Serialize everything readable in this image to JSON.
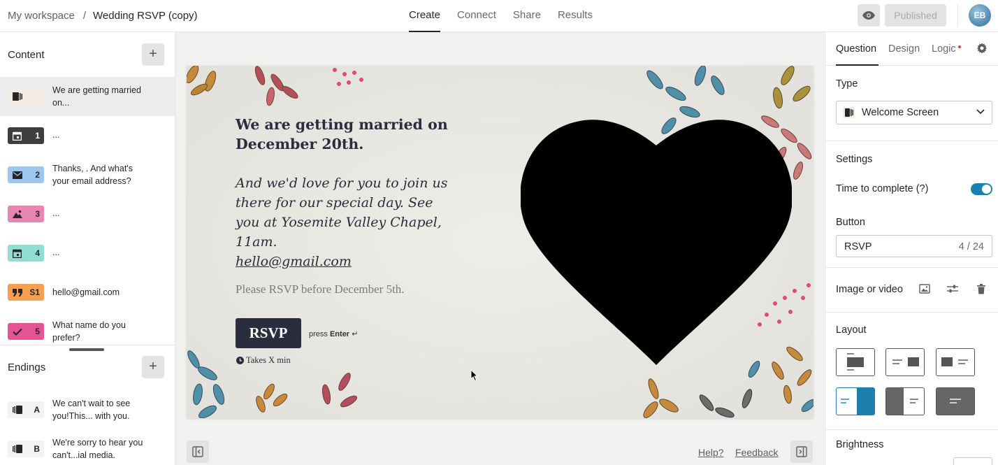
{
  "breadcrumb": {
    "workspace": "My workspace",
    "separator": "/",
    "form": "Wedding RSVP (copy)"
  },
  "nav": {
    "tabs": [
      "Create",
      "Connect",
      "Share",
      "Results"
    ],
    "active": "Create"
  },
  "header": {
    "published_label": "Published",
    "avatar_initials": "EB"
  },
  "content": {
    "title": "Content",
    "add_label": "+",
    "items": [
      {
        "badge": "",
        "icon": "welcome-screen-icon",
        "color": "#f3ece3",
        "text": "We are getting married on..."
      },
      {
        "badge": "1",
        "icon": "calendar-icon",
        "color": "#3e3e3e",
        "text": "..."
      },
      {
        "badge": "2",
        "icon": "email-icon",
        "color": "#9fc6ee",
        "text": "Thanks, . And what's your email address?"
      },
      {
        "badge": "3",
        "icon": "picture-choice-icon",
        "color": "#e785b3",
        "text": "..."
      },
      {
        "badge": "4",
        "icon": "calendar-icon",
        "color": "#8fddd4",
        "text": "..."
      },
      {
        "badge": "S1",
        "icon": "statement-quote-icon",
        "color": "#f5a04e",
        "text": "hello@gmail.com"
      },
      {
        "badge": "5",
        "icon": "checkmark-icon",
        "color": "#e45495",
        "text": "What name do you prefer?"
      }
    ]
  },
  "endings": {
    "title": "Endings",
    "add_label": "+",
    "items": [
      {
        "badge": "A",
        "icon": "ending-screen-icon",
        "text": "We can't wait to see you!This... with you."
      },
      {
        "badge": "B",
        "icon": "ending-screen-icon",
        "text": "We're sorry to hear you can't...ial media."
      }
    ]
  },
  "card": {
    "headline": "We are getting married on December 20th.",
    "body": "And we'd love for you to join us there for our special day. See you at Yosemite Valley Chapel, 11am.",
    "email": "hello@gmail.com",
    "note": "Please RSVP before December 5th.",
    "button_label": "RSVP",
    "press_prefix": "press",
    "press_key": "Enter",
    "press_glyph": "↵",
    "takes": "Takes X min",
    "heart_color": "#000000"
  },
  "footer": {
    "help": "Help?",
    "feedback": "Feedback"
  },
  "panel": {
    "tabs": [
      "Question",
      "Design",
      "Logic"
    ],
    "active_tab": "Question",
    "type_label": "Type",
    "type_value": "Welcome Screen",
    "settings_label": "Settings",
    "time_to_complete_label": "Time to complete (?)",
    "time_to_complete_enabled": true,
    "button_label": "Button",
    "button_value": "RSVP",
    "button_count": "4 / 24",
    "image_video_label": "Image or video",
    "layout_label": "Layout",
    "layout_selected_index": 3,
    "brightness_label": "Brightness",
    "accent_color": "#1d7fae"
  }
}
